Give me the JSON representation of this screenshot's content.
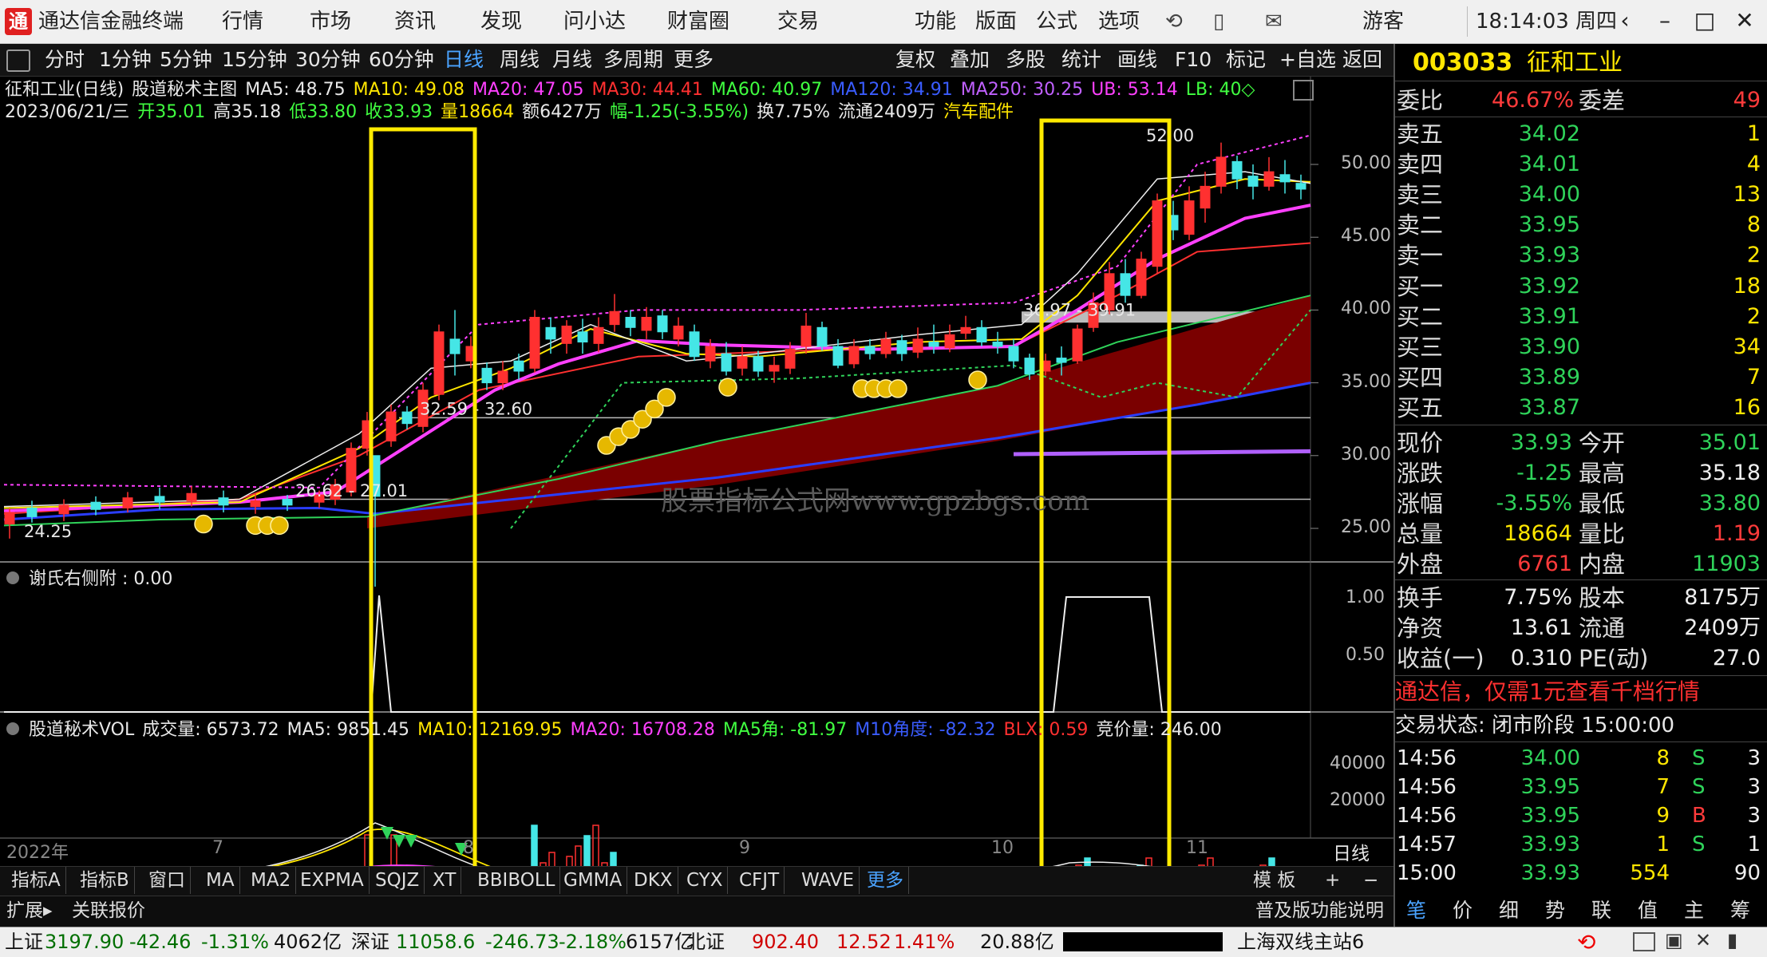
{
  "app": {
    "title": "通达信金融终端",
    "logo_char": "通"
  },
  "menu": [
    "行情",
    "市场",
    "资讯",
    "发现",
    "问小达",
    "财富圈",
    "交易",
    "功能",
    "版面",
    "公式",
    "选项"
  ],
  "title_right": {
    "user": "游客",
    "clock": "18:14:03 周四"
  },
  "toolbar": {
    "periods": [
      "分时",
      "1分钟",
      "5分钟",
      "15分钟",
      "30分钟",
      "60分钟",
      "日线",
      "周线",
      "月线",
      "多周期",
      "更多"
    ],
    "active_period": "日线",
    "actions": [
      "复权",
      "叠加",
      "多股",
      "统计",
      "画线",
      "F10",
      "标记",
      "+自选",
      "返回"
    ]
  },
  "main_header": {
    "line1": [
      {
        "t": "征和工业(日线)",
        "c": "#e8e8e8"
      },
      {
        "t": "股道秘术主图",
        "c": "#e8e8e8"
      },
      {
        "t": "MA5: 48.75",
        "c": "#e8e8e8"
      },
      {
        "t": "MA10: 49.08",
        "c": "#ffe600"
      },
      {
        "t": "MA20: 47.05",
        "c": "#ff40ff"
      },
      {
        "t": "MA30: 44.41",
        "c": "#ff3030"
      },
      {
        "t": "MA60: 40.97",
        "c": "#40ff40"
      },
      {
        "t": "MA120: 34.91",
        "c": "#3a5cff"
      },
      {
        "t": "MA250: 30.25",
        "c": "#c060ff"
      },
      {
        "t": "UB: 53.14",
        "c": "#ff40ff"
      },
      {
        "t": "LB: 40◇",
        "c": "#40ff40"
      }
    ],
    "line2": [
      {
        "t": "2023/06/21/三",
        "c": "#e8e8e8"
      },
      {
        "t": "开35.01",
        "c": "#40ff40"
      },
      {
        "t": "高35.18",
        "c": "#e8e8e8"
      },
      {
        "t": "低33.80",
        "c": "#40ff40"
      },
      {
        "t": "收33.93",
        "c": "#40ff40"
      },
      {
        "t": "量18664",
        "c": "#ffe600"
      },
      {
        "t": "额6427万",
        "c": "#e8e8e8"
      },
      {
        "t": "幅-1.25(-3.55%)",
        "c": "#40ff40"
      },
      {
        "t": "换7.75%",
        "c": "#e8e8e8"
      },
      {
        "t": "流通2409万",
        "c": "#e8e8e8"
      },
      {
        "t": "汽车配件",
        "c": "#ffe600"
      }
    ]
  },
  "price_axis": [
    "50.00",
    "45.00",
    "40.00",
    "35.00",
    "30.00",
    "25.00"
  ],
  "chart_annotations": {
    "high": "52.00",
    "low": "24.25",
    "mid1": "32.59 - 32.60",
    "mid2": "26.62 - 27.01",
    "mid3": "36.97 - 39.91"
  },
  "watermark": "股票指标公式网www.gpzbgs.com",
  "indicator1": {
    "label": "谢氏右侧附 : 0.00",
    "axis": [
      "1.00",
      "0.50"
    ]
  },
  "indicator2": {
    "parts": [
      {
        "t": "股道秘术VOL",
        "c": "#e8e8e8"
      },
      {
        "t": "成交量: 6573.72",
        "c": "#e8e8e8"
      },
      {
        "t": "MA5: 9851.45",
        "c": "#e8e8e8"
      },
      {
        "t": "MA10: 12169.95",
        "c": "#ffe600"
      },
      {
        "t": "MA20: 16708.28",
        "c": "#ff40ff"
      },
      {
        "t": "MA5角: -81.97",
        "c": "#40ff40"
      },
      {
        "t": "M10角度: -82.32",
        "c": "#3a5cff"
      },
      {
        "t": "BLX: 0.59",
        "c": "#ff3030"
      },
      {
        "t": "竞价量: 246.00",
        "c": "#e8e8e8"
      }
    ],
    "axis": [
      "40000",
      "20000"
    ]
  },
  "date_axis": [
    "2022年",
    "7",
    "8",
    "9",
    "10",
    "11"
  ],
  "date_axis_right": "日线",
  "bottom_tabs": [
    "指标A",
    "指标B",
    "窗口",
    "MA",
    "MA2",
    "EXPMA",
    "SQJZ",
    "XT",
    "BBIBOLL",
    "GMMA",
    "DKX",
    "CYX",
    "CFJT",
    "WAVE",
    "更多"
  ],
  "bottom_tabs_right": {
    "template": "模 板",
    "plus": "+",
    "minus": "−"
  },
  "ext_bar": {
    "left": [
      "扩展▸",
      "关联报价"
    ],
    "right": "普及版功能说明",
    "tabs": [
      "笔",
      "价",
      "细",
      "势",
      "联",
      "值",
      "主",
      "筹"
    ]
  },
  "stock": {
    "code": "003033",
    "name": "征和工业"
  },
  "weibi": {
    "label": "委比",
    "value": "46.67%",
    "label2": "委差",
    "value2": "49"
  },
  "sell": [
    {
      "l": "卖五",
      "p": "34.02",
      "v": "1"
    },
    {
      "l": "卖四",
      "p": "34.01",
      "v": "4"
    },
    {
      "l": "卖三",
      "p": "34.00",
      "v": "13"
    },
    {
      "l": "卖二",
      "p": "33.95",
      "v": "8"
    },
    {
      "l": "卖一",
      "p": "33.93",
      "v": "2"
    }
  ],
  "buy": [
    {
      "l": "买一",
      "p": "33.92",
      "v": "18"
    },
    {
      "l": "买二",
      "p": "33.91",
      "v": "2"
    },
    {
      "l": "买三",
      "p": "33.90",
      "v": "34"
    },
    {
      "l": "买四",
      "p": "33.89",
      "v": "7"
    },
    {
      "l": "买五",
      "p": "33.87",
      "v": "16"
    }
  ],
  "quote": [
    {
      "l": "现价",
      "v": "33.93",
      "vc": "green",
      "l2": "今开",
      "v2": "35.01",
      "v2c": "green"
    },
    {
      "l": "涨跌",
      "v": "-1.25",
      "vc": "green",
      "l2": "最高",
      "v2": "35.18",
      "v2c": "white"
    },
    {
      "l": "涨幅",
      "v": "-3.55%",
      "vc": "green",
      "l2": "最低",
      "v2": "33.80",
      "v2c": "green"
    },
    {
      "l": "总量",
      "v": "18664",
      "vc": "yellow",
      "l2": "量比",
      "v2": "1.19",
      "v2c": "red"
    },
    {
      "l": "外盘",
      "v": "6761",
      "vc": "red",
      "l2": "内盘",
      "v2": "11903",
      "v2c": "green"
    }
  ],
  "fund": [
    {
      "l": "换手",
      "v": "7.75%",
      "l2": "股本",
      "v2": "8175万"
    },
    {
      "l": "净资",
      "v": "13.61",
      "l2": "流通",
      "v2": "2409万"
    },
    {
      "l": "收益(一)",
      "v": "0.310",
      "l2": "PE(动)",
      "v2": "27.0"
    }
  ],
  "promo": "通达信，仅需1元查看千档行情",
  "trade_status": "交易状态: 闭市阶段 15:00:00",
  "ticks": [
    {
      "t": "14:56",
      "p": "34.00",
      "v": "8",
      "bs": "S",
      "n": "3"
    },
    {
      "t": "14:56",
      "p": "33.95",
      "v": "7",
      "bs": "S",
      "n": "3"
    },
    {
      "t": "14:56",
      "p": "33.95",
      "v": "9",
      "bs": "B",
      "n": "3"
    },
    {
      "t": "14:57",
      "p": "33.93",
      "v": "1",
      "bs": "S",
      "n": "1"
    },
    {
      "t": "15:00",
      "p": "33.93",
      "v": "554",
      "bs": "",
      "n": "90"
    }
  ],
  "statusbar": {
    "sh_name": "上证",
    "sh_val": "3197.90",
    "sh_chg": "-42.46",
    "sh_pct": "-1.31%",
    "sh_amt": "4062亿",
    "sz_name": "深证",
    "sz_val": "11058.6",
    "sz_chg": "-246.73",
    "sz_pct": "-2.18%",
    "sz_amt": "6157亿",
    "bj_name": "北证",
    "bj_val": "902.40",
    "bj_chg": "12.52",
    "bj_pct": "1.41%",
    "bj_amt": "20.88亿",
    "server": "上海双线主站6"
  }
}
